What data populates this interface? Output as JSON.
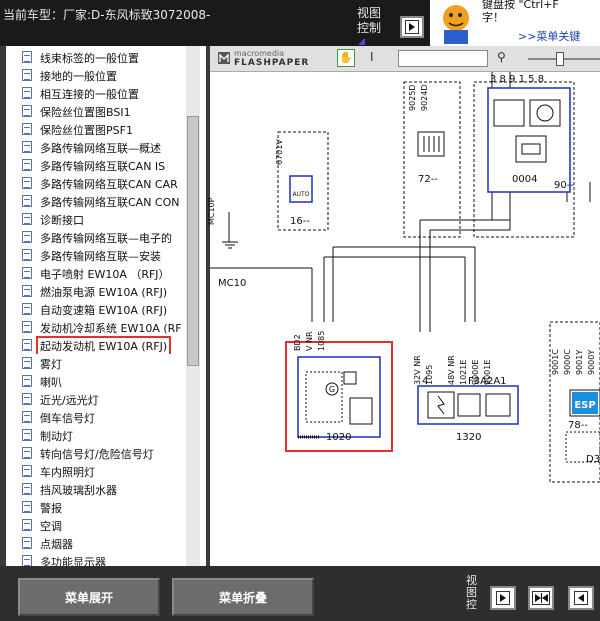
{
  "header": {
    "vehicle_label": "当前车型：厂家:D-东风标致3072008-",
    "view_control_label": "视图\n控制",
    "tip_text_line1": "键盘按 \"Ctrl+F",
    "tip_text_line2": "字！",
    "tip_link": ">>菜单关键"
  },
  "menu": {
    "items": [
      "线束标签的一般位置",
      "接地的一般位置",
      "相互连接的一般位置",
      "保险丝位置图BSI1",
      "保险丝位置图PSF1",
      "多路传输网络互联—概述",
      "多路传输网络互联CAN IS",
      "多路传输网络互联CAN CAR",
      "多路传输网络互联CAN CON",
      "诊断接口",
      "多路传输网络互联—电子的",
      "多路传输网络互联—安装",
      "电子喷射 EW10A （RFJ）",
      "燃油泵电源 EW10A (RFJ)",
      "自动变速箱 EW10A (RFJ)",
      "发动机冷却系统 EW10A (RF",
      "起动发动机 EW10A (RFJ)",
      "雾灯",
      "喇叭",
      "近光/远光灯",
      "倒车信号灯",
      "制动灯",
      "转向信号灯/危险信号灯",
      "车内照明灯",
      "挡风玻璃刮水器",
      "警报",
      "空调",
      "点烟器",
      "多功能显示器"
    ],
    "selected_index": 16
  },
  "document": {
    "logo_line1": "macromedia",
    "logo_line2": "FLASHPAPER",
    "diagram": {
      "labels": {
        "c_6701v": "6701V",
        "c_16": "16--",
        "c_mc10p": "MC10P",
        "c_mc10": "MC10",
        "c_9025d": "9025D",
        "c_9024d": "9024D",
        "c_72": "72--",
        "c_pins": "3 8 9 1 5 8",
        "c_0004": "0004",
        "c_90": "90--",
        "c_bd2": "BD2",
        "c_nr": "V NR",
        "c_1085": "1085",
        "c_1020": "1020",
        "c_32v": "32V NR",
        "c_1095": "1095",
        "c_48v": "48V NR",
        "c_1021e": "1021E",
        "c_9000e": "9000E",
        "c_9001e": "9001E",
        "c_f3": "F3A2A1",
        "c_1320": "1320",
        "c_4": "4",
        "c_9001c": "9001C",
        "c_9000c": "9000C",
        "c_9001y": "9001Y",
        "c_9000y": "9000Y",
        "c_esp": "ESP",
        "c_78": "78--",
        "c_d3": "D3"
      }
    }
  },
  "footer": {
    "expand_label": "菜单展开",
    "collapse_label": "菜单折叠",
    "view_control_label": "视\n图\n控"
  },
  "colors": {
    "accent_blue": "#1a2fc0",
    "highlight_red": "#e03030"
  }
}
